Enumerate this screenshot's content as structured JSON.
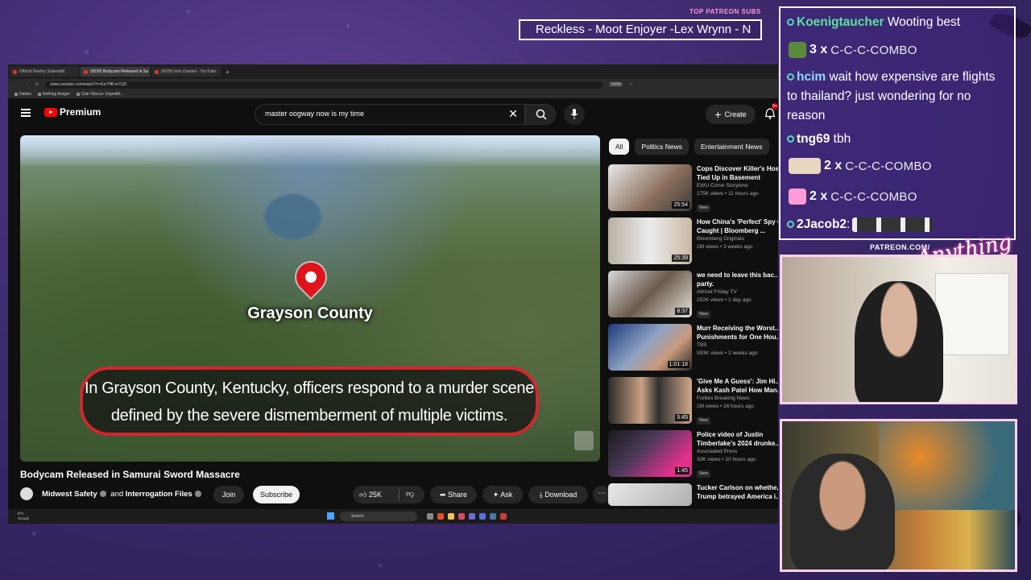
{
  "overlay": {
    "patreon_label": "TOP PATREON SUBS",
    "patreon_names": "Reckless - Moot Enjoyer -Lex Wrynn - N",
    "patreon_url": "PATREON.COM/",
    "script_logo": "Anything else"
  },
  "browser": {
    "tabs": [
      {
        "label": "Official Destiny Subreddit",
        "active": false
      },
      {
        "label": "(6029) Bodycam Released in Sa",
        "active": true
      },
      {
        "label": "(6029) Irish Zionism - YouTube",
        "active": false
      }
    ],
    "url": "www.youtube.com/watch?v=Ee7HB-m7QD",
    "zoom": "150%",
    "bookmarks": [
      "Dailies",
      "Nothing Burger",
      "Clair Obscur: Expediti..."
    ]
  },
  "youtube": {
    "logo": "Premium",
    "search_value": "master oogway now is my time",
    "create_label": "Create",
    "notification_count": "9+",
    "video": {
      "map_label": "Grayson County",
      "subtitle_line1": "In Grayson County, Kentucky, officers respond to a murder scene",
      "subtitle_line2": "defined by the severe dismemberment of multiple victims.",
      "title": "Bodycam Released in Samurai Sword Massacre",
      "channel": "Midwest Safety",
      "channel_connector": "and",
      "channel2": "Interrogation Files",
      "join": "Join",
      "subscribe": "Subscribe",
      "likes": "25K",
      "share": "Share",
      "ask": "Ask",
      "download": "Download"
    },
    "chips": [
      "All",
      "Politics News",
      "Entertainment News"
    ],
    "recommendations": [
      {
        "title": "Cops Discover Killer's Hos...",
        "title2": "Tied Up in Basement",
        "channel": "EWU Crime Storytime",
        "meta": "175K views • 11 hours ago",
        "duration": "25:54",
        "new": "New"
      },
      {
        "title": "How China's 'Perfect' Spy G...",
        "title2": "Caught | Bloomberg ...",
        "channel": "Bloomberg Originals",
        "meta": "2M views • 3 weeks ago",
        "duration": "25:39",
        "new": ""
      },
      {
        "title": "we need to leave this bac...",
        "title2": "party.",
        "channel": "Almost Friday TV",
        "meta": "252K views • 1 day ago",
        "duration": "8:37",
        "new": "New"
      },
      {
        "title": "Murr Receiving the Worst...",
        "title2": "Punishments for One Hou...",
        "channel": "TBS",
        "meta": "593K views • 2 weeks ago",
        "duration": "1:01:18",
        "new": ""
      },
      {
        "title": "'Give Me A Guess': Jim Hi...",
        "title2": "Asks Kash Patel How Man...",
        "channel": "Forbes Breaking News",
        "meta": "2M views • 16 hours ago",
        "duration": "5:45",
        "new": "New"
      },
      {
        "title": "Police video of Justin",
        "title2": "Timberlake's 2024 drunke...",
        "channel": "Associated Press",
        "meta": "33K views • 10 hours ago",
        "duration": "1:45",
        "new": "New"
      },
      {
        "title": "Tucker Carlson on whethe...",
        "title2": "Trump betrayed America i...",
        "channel": "",
        "meta": "",
        "duration": "",
        "new": ""
      }
    ]
  },
  "taskbar": {
    "weather_temp": "9°C",
    "weather_desc": "Cloudy",
    "search_label": "Search"
  },
  "chat": {
    "messages": [
      {
        "name": "Koenigtaucher",
        "text": " Wooting best",
        "color": "#5de0a0"
      },
      {
        "combo_count": "3 x",
        "combo_text": "C-C-C-COMBO"
      },
      {
        "name": "hcim",
        "text": " wait how expensive are flights to thailand? just wondering for no reason",
        "color": "#8fd8ff"
      },
      {
        "name": "tng69",
        "text": " tbh",
        "color": "#ffffff"
      },
      {
        "combo_count": "2 x",
        "combo_text": "C-C-C-COMBO"
      },
      {
        "combo_count": "2 x",
        "combo_text": "C-C-C-COMBO"
      },
      {
        "name": "2Jacob2",
        "text": "",
        "color": "#ffffff"
      }
    ]
  },
  "colors": {
    "youtube_red": "#ff0000",
    "subtitle_border": "#d3262f",
    "overlay_purple": "#3d2a6e",
    "cam_border": "#ffd3ef"
  }
}
